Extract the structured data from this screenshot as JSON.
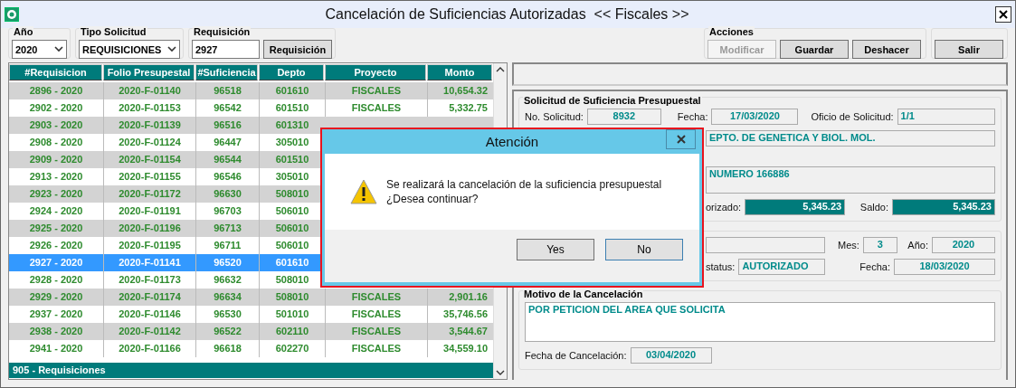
{
  "window": {
    "title": "Cancelación de Suficiencias Autorizadas  << Fiscales >>"
  },
  "filters": {
    "year": {
      "label": "Año",
      "value": "2020"
    },
    "type": {
      "label": "Tipo Solicitud",
      "value": "REQUISICIONES"
    },
    "requisition": {
      "label": "Requisición",
      "value": "2927",
      "button": "Requisición"
    }
  },
  "actions": {
    "label": "Acciones",
    "buttons": [
      {
        "label": "Modificar",
        "disabled": true
      },
      {
        "label": "Guardar",
        "disabled": false
      },
      {
        "label": "Deshacer",
        "disabled": false
      }
    ],
    "exit": "Salir"
  },
  "table": {
    "columns": [
      "#Requisicion",
      "Folio Presupestal",
      "#Suficiencia",
      "Depto",
      "Proyecto",
      "Monto"
    ],
    "rows": [
      {
        "cells": [
          "2896 - 2020",
          "2020-F-01140",
          "96518",
          "601610",
          "FISCALES",
          "10,654.32"
        ],
        "selected": false
      },
      {
        "cells": [
          "2902 - 2020",
          "2020-F-01153",
          "96542",
          "601510",
          "FISCALES",
          "5,332.75"
        ],
        "selected": false
      },
      {
        "cells": [
          "2903 - 2020",
          "2020-F-01139",
          "96516",
          "601310"
        ],
        "selected": false
      },
      {
        "cells": [
          "2908 - 2020",
          "2020-F-01124",
          "96447",
          "305010"
        ],
        "selected": false
      },
      {
        "cells": [
          "2909 - 2020",
          "2020-F-01154",
          "96544",
          "601510"
        ],
        "selected": false
      },
      {
        "cells": [
          "2913 - 2020",
          "2020-F-01155",
          "96546",
          "305010"
        ],
        "selected": false
      },
      {
        "cells": [
          "2923 - 2020",
          "2020-F-01172",
          "96630",
          "508010"
        ],
        "selected": false
      },
      {
        "cells": [
          "2924 - 2020",
          "2020-F-01191",
          "96703",
          "506010"
        ],
        "selected": false
      },
      {
        "cells": [
          "2925 - 2020",
          "2020-F-01196",
          "96713",
          "506010"
        ],
        "selected": false
      },
      {
        "cells": [
          "2926 - 2020",
          "2020-F-01195",
          "96711",
          "506010"
        ],
        "selected": false
      },
      {
        "cells": [
          "2927 - 2020",
          "2020-F-01141",
          "96520",
          "601610"
        ],
        "selected": true
      },
      {
        "cells": [
          "2928 - 2020",
          "2020-F-01173",
          "96632",
          "508010"
        ],
        "selected": false
      },
      {
        "cells": [
          "2929 - 2020",
          "2020-F-01174",
          "96634",
          "508010",
          "FISCALES",
          "2,901.16"
        ],
        "selected": false
      },
      {
        "cells": [
          "2937 - 2020",
          "2020-F-01146",
          "96530",
          "501010",
          "FISCALES",
          "35,746.56"
        ],
        "selected": false
      },
      {
        "cells": [
          "2938 - 2020",
          "2020-F-01142",
          "96522",
          "602110",
          "FISCALES",
          "3,544.67"
        ],
        "selected": false
      },
      {
        "cells": [
          "2941 - 2020",
          "2020-F-01166",
          "96618",
          "602270",
          "FISCALES",
          "34,559.10"
        ],
        "selected": false
      }
    ],
    "footer": "905 - Requisiciones"
  },
  "request": {
    "title": "Solicitud de Suficiencia Presupuestal",
    "number": {
      "label": "No. Solicitud:",
      "value": "8932"
    },
    "date": {
      "label": "Fecha:",
      "value": "17/03/2020"
    },
    "office": {
      "label": "Oficio de Solicitud:",
      "value": "1/1"
    },
    "department": "EPTO. DE GENETICA Y BIOL. MOL.",
    "description": "NUMERO 166886",
    "authorized": {
      "label": "orizado:",
      "value": "5,345.23"
    },
    "balance": {
      "label": "Saldo:",
      "value": "5,345.23"
    }
  },
  "status_section": {
    "month": {
      "label": "Mes:",
      "value": "3"
    },
    "year": {
      "label": "Año:",
      "value": "2020"
    },
    "status": {
      "label": "status:",
      "value": "AUTORIZADO"
    },
    "date": {
      "label": "Fecha:",
      "value": "18/03/2020"
    }
  },
  "cancellation": {
    "title": "Motivo de la Cancelación",
    "reason": "POR PETICION DEL AREA QUE SOLICITA",
    "date": {
      "label": "Fecha de Cancelación:",
      "value": "03/04/2020"
    }
  },
  "dialog": {
    "title": "Atención",
    "message": "Se realizará la cancelación de la suficiencia presupuestal\n¿Desea continuar?",
    "buttons": [
      "Yes",
      "No"
    ]
  }
}
